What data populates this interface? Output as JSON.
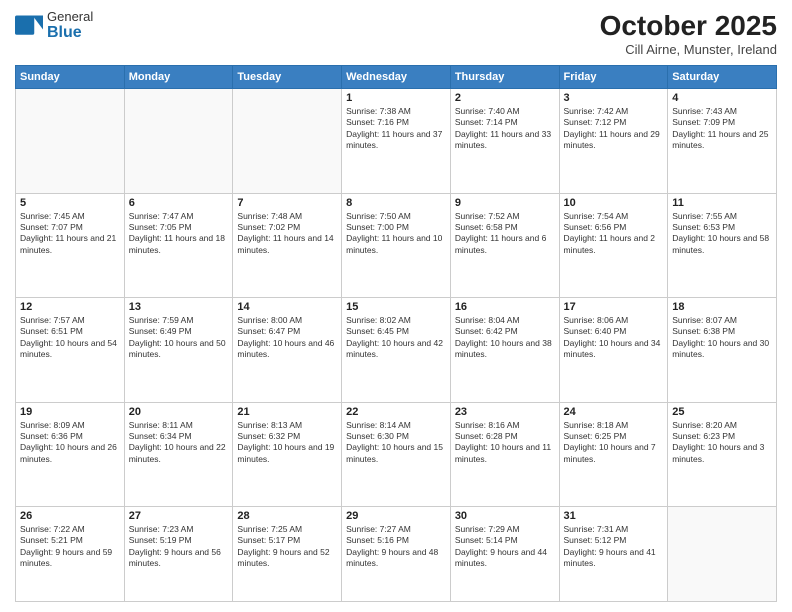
{
  "logo": {
    "general": "General",
    "blue": "Blue"
  },
  "header": {
    "month": "October 2025",
    "location": "Cill Airne, Munster, Ireland"
  },
  "weekdays": [
    "Sunday",
    "Monday",
    "Tuesday",
    "Wednesday",
    "Thursday",
    "Friday",
    "Saturday"
  ],
  "weeks": [
    [
      {
        "day": null
      },
      {
        "day": null
      },
      {
        "day": null
      },
      {
        "day": "1",
        "sunrise": "Sunrise: 7:38 AM",
        "sunset": "Sunset: 7:16 PM",
        "daylight": "Daylight: 11 hours and 37 minutes."
      },
      {
        "day": "2",
        "sunrise": "Sunrise: 7:40 AM",
        "sunset": "Sunset: 7:14 PM",
        "daylight": "Daylight: 11 hours and 33 minutes."
      },
      {
        "day": "3",
        "sunrise": "Sunrise: 7:42 AM",
        "sunset": "Sunset: 7:12 PM",
        "daylight": "Daylight: 11 hours and 29 minutes."
      },
      {
        "day": "4",
        "sunrise": "Sunrise: 7:43 AM",
        "sunset": "Sunset: 7:09 PM",
        "daylight": "Daylight: 11 hours and 25 minutes."
      }
    ],
    [
      {
        "day": "5",
        "sunrise": "Sunrise: 7:45 AM",
        "sunset": "Sunset: 7:07 PM",
        "daylight": "Daylight: 11 hours and 21 minutes."
      },
      {
        "day": "6",
        "sunrise": "Sunrise: 7:47 AM",
        "sunset": "Sunset: 7:05 PM",
        "daylight": "Daylight: 11 hours and 18 minutes."
      },
      {
        "day": "7",
        "sunrise": "Sunrise: 7:48 AM",
        "sunset": "Sunset: 7:02 PM",
        "daylight": "Daylight: 11 hours and 14 minutes."
      },
      {
        "day": "8",
        "sunrise": "Sunrise: 7:50 AM",
        "sunset": "Sunset: 7:00 PM",
        "daylight": "Daylight: 11 hours and 10 minutes."
      },
      {
        "day": "9",
        "sunrise": "Sunrise: 7:52 AM",
        "sunset": "Sunset: 6:58 PM",
        "daylight": "Daylight: 11 hours and 6 minutes."
      },
      {
        "day": "10",
        "sunrise": "Sunrise: 7:54 AM",
        "sunset": "Sunset: 6:56 PM",
        "daylight": "Daylight: 11 hours and 2 minutes."
      },
      {
        "day": "11",
        "sunrise": "Sunrise: 7:55 AM",
        "sunset": "Sunset: 6:53 PM",
        "daylight": "Daylight: 10 hours and 58 minutes."
      }
    ],
    [
      {
        "day": "12",
        "sunrise": "Sunrise: 7:57 AM",
        "sunset": "Sunset: 6:51 PM",
        "daylight": "Daylight: 10 hours and 54 minutes."
      },
      {
        "day": "13",
        "sunrise": "Sunrise: 7:59 AM",
        "sunset": "Sunset: 6:49 PM",
        "daylight": "Daylight: 10 hours and 50 minutes."
      },
      {
        "day": "14",
        "sunrise": "Sunrise: 8:00 AM",
        "sunset": "Sunset: 6:47 PM",
        "daylight": "Daylight: 10 hours and 46 minutes."
      },
      {
        "day": "15",
        "sunrise": "Sunrise: 8:02 AM",
        "sunset": "Sunset: 6:45 PM",
        "daylight": "Daylight: 10 hours and 42 minutes."
      },
      {
        "day": "16",
        "sunrise": "Sunrise: 8:04 AM",
        "sunset": "Sunset: 6:42 PM",
        "daylight": "Daylight: 10 hours and 38 minutes."
      },
      {
        "day": "17",
        "sunrise": "Sunrise: 8:06 AM",
        "sunset": "Sunset: 6:40 PM",
        "daylight": "Daylight: 10 hours and 34 minutes."
      },
      {
        "day": "18",
        "sunrise": "Sunrise: 8:07 AM",
        "sunset": "Sunset: 6:38 PM",
        "daylight": "Daylight: 10 hours and 30 minutes."
      }
    ],
    [
      {
        "day": "19",
        "sunrise": "Sunrise: 8:09 AM",
        "sunset": "Sunset: 6:36 PM",
        "daylight": "Daylight: 10 hours and 26 minutes."
      },
      {
        "day": "20",
        "sunrise": "Sunrise: 8:11 AM",
        "sunset": "Sunset: 6:34 PM",
        "daylight": "Daylight: 10 hours and 22 minutes."
      },
      {
        "day": "21",
        "sunrise": "Sunrise: 8:13 AM",
        "sunset": "Sunset: 6:32 PM",
        "daylight": "Daylight: 10 hours and 19 minutes."
      },
      {
        "day": "22",
        "sunrise": "Sunrise: 8:14 AM",
        "sunset": "Sunset: 6:30 PM",
        "daylight": "Daylight: 10 hours and 15 minutes."
      },
      {
        "day": "23",
        "sunrise": "Sunrise: 8:16 AM",
        "sunset": "Sunset: 6:28 PM",
        "daylight": "Daylight: 10 hours and 11 minutes."
      },
      {
        "day": "24",
        "sunrise": "Sunrise: 8:18 AM",
        "sunset": "Sunset: 6:25 PM",
        "daylight": "Daylight: 10 hours and 7 minutes."
      },
      {
        "day": "25",
        "sunrise": "Sunrise: 8:20 AM",
        "sunset": "Sunset: 6:23 PM",
        "daylight": "Daylight: 10 hours and 3 minutes."
      }
    ],
    [
      {
        "day": "26",
        "sunrise": "Sunrise: 7:22 AM",
        "sunset": "Sunset: 5:21 PM",
        "daylight": "Daylight: 9 hours and 59 minutes."
      },
      {
        "day": "27",
        "sunrise": "Sunrise: 7:23 AM",
        "sunset": "Sunset: 5:19 PM",
        "daylight": "Daylight: 9 hours and 56 minutes."
      },
      {
        "day": "28",
        "sunrise": "Sunrise: 7:25 AM",
        "sunset": "Sunset: 5:17 PM",
        "daylight": "Daylight: 9 hours and 52 minutes."
      },
      {
        "day": "29",
        "sunrise": "Sunrise: 7:27 AM",
        "sunset": "Sunset: 5:16 PM",
        "daylight": "Daylight: 9 hours and 48 minutes."
      },
      {
        "day": "30",
        "sunrise": "Sunrise: 7:29 AM",
        "sunset": "Sunset: 5:14 PM",
        "daylight": "Daylight: 9 hours and 44 minutes."
      },
      {
        "day": "31",
        "sunrise": "Sunrise: 7:31 AM",
        "sunset": "Sunset: 5:12 PM",
        "daylight": "Daylight: 9 hours and 41 minutes."
      },
      {
        "day": null
      }
    ]
  ]
}
